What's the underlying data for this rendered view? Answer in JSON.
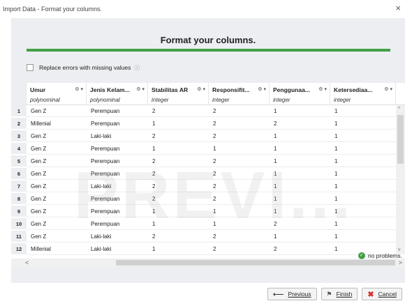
{
  "window": {
    "title": "Import Data - Format your columns.",
    "close_glyph": "×"
  },
  "heading": "Format your columns.",
  "progress_color": "#43a047",
  "replace_errors": {
    "label": "Replace errors with missing values",
    "checked": false,
    "info_icon": "ⓘ"
  },
  "columns": [
    {
      "name": "Umur",
      "type": "polynominal",
      "icons": "⚙ ▾"
    },
    {
      "name": "Jenis Kelam...",
      "type": "polynominal",
      "icons": "⚙ ▾"
    },
    {
      "name": "Stabilitas AR",
      "type": "integer",
      "icons": "⚙ ▾"
    },
    {
      "name": "Responsifit...",
      "type": "integer",
      "icons": "⚙ ▾"
    },
    {
      "name": "Penggunaa...",
      "type": "integer",
      "icons": "⚙ ▾"
    },
    {
      "name": "Ketersediaa...",
      "type": "integer",
      "icons": "⚙ ▾"
    }
  ],
  "rows": [
    {
      "num": "1",
      "cells": [
        "Gen Z",
        "Perempuan",
        "2",
        "2",
        "1",
        "1"
      ]
    },
    {
      "num": "2",
      "cells": [
        "Millenial",
        "Perempuan",
        "1",
        "2",
        "2",
        "1"
      ]
    },
    {
      "num": "3",
      "cells": [
        "Gen Z",
        "Laki-laki",
        "2",
        "2",
        "1",
        "1"
      ]
    },
    {
      "num": "4",
      "cells": [
        "Gen Z",
        "Perempuan",
        "1",
        "1",
        "1",
        "1"
      ]
    },
    {
      "num": "5",
      "cells": [
        "Gen Z",
        "Perempuan",
        "2",
        "2",
        "1",
        "1"
      ]
    },
    {
      "num": "6",
      "cells": [
        "Gen Z",
        "Perempuan",
        "2",
        "2",
        "1",
        "1"
      ]
    },
    {
      "num": "7",
      "cells": [
        "Gen Z",
        "Laki-laki",
        "2",
        "2",
        "1",
        "1"
      ]
    },
    {
      "num": "8",
      "cells": [
        "Gen Z",
        "Perempuan",
        "2",
        "2",
        "1",
        "1"
      ]
    },
    {
      "num": "9",
      "cells": [
        "Gen Z",
        "Perempuan",
        "1",
        "1",
        "1",
        "1"
      ]
    },
    {
      "num": "10",
      "cells": [
        "Gen Z",
        "Perempuan",
        "1",
        "1",
        "2",
        "1"
      ]
    },
    {
      "num": "11",
      "cells": [
        "Gen Z",
        "Laki-laki",
        "2",
        "2",
        "1",
        "1"
      ]
    },
    {
      "num": "12",
      "cells": [
        "Millenial",
        "Laki-laki",
        "1",
        "2",
        "2",
        "1"
      ]
    }
  ],
  "watermark": "PREVI...",
  "status": {
    "text": "no problems.",
    "icon": "✓"
  },
  "buttons": {
    "previous": {
      "label": "Previous",
      "icon": "⟵"
    },
    "finish": {
      "label": "Finish",
      "icon": "⚑"
    },
    "cancel": {
      "label": "Cancel",
      "icon": "✖"
    }
  }
}
